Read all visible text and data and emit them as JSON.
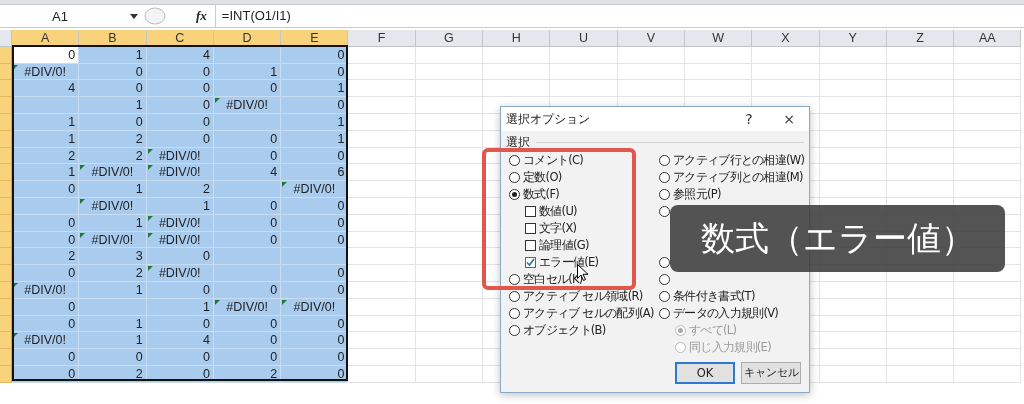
{
  "formula_bar": {
    "name_box": "A1",
    "fx": "fx",
    "formula": "=INT(O1/I1)"
  },
  "sheet": {
    "columns": [
      {
        "label": "A",
        "selected": true
      },
      {
        "label": "B",
        "selected": true
      },
      {
        "label": "C",
        "selected": true
      },
      {
        "label": "D",
        "selected": true
      },
      {
        "label": "E",
        "selected": true
      },
      {
        "label": "F",
        "selected": false
      },
      {
        "label": "G",
        "selected": false
      },
      {
        "label": "H",
        "selected": false
      },
      {
        "label": "U",
        "selected": false
      },
      {
        "label": "V",
        "selected": false
      },
      {
        "label": "W",
        "selected": false
      },
      {
        "label": "X",
        "selected": false
      },
      {
        "label": "Y",
        "selected": false
      },
      {
        "label": "Z",
        "selected": false
      },
      {
        "label": "AA",
        "selected": false
      }
    ],
    "rows": [
      [
        "0",
        "1",
        "4",
        null,
        "0"
      ],
      [
        {
          "text": "#DIV/0!",
          "kind": "error"
        },
        "0",
        "0",
        "1",
        "0"
      ],
      [
        "4",
        "0",
        "0",
        "0",
        "1"
      ],
      [
        null,
        "1",
        "0",
        {
          "text": "#DIV/0!",
          "kind": "error"
        },
        "0"
      ],
      [
        "1",
        "0",
        "0",
        null,
        "1"
      ],
      [
        "1",
        "2",
        "0",
        "0",
        "1"
      ],
      [
        "2",
        "2",
        {
          "text": "#DIV/0!",
          "kind": "error"
        },
        "0",
        "0"
      ],
      [
        "1",
        {
          "text": "#DIV/0!",
          "kind": "error"
        },
        {
          "text": "#DIV/0!",
          "kind": "error"
        },
        "4",
        "6"
      ],
      [
        "0",
        "1",
        "2",
        null,
        {
          "text": "#DIV/0!",
          "kind": "error"
        }
      ],
      [
        null,
        {
          "text": "#DIV/0!",
          "kind": "error"
        },
        "1",
        "0",
        "0"
      ],
      [
        "0",
        "1",
        {
          "text": "#DIV/0!",
          "kind": "error"
        },
        "0",
        "0"
      ],
      [
        "0",
        {
          "text": "#DIV/0!",
          "kind": "error"
        },
        {
          "text": "#DIV/0!",
          "kind": "error"
        },
        "0",
        "0"
      ],
      [
        "2",
        "3",
        "0",
        null,
        null
      ],
      [
        "0",
        "2",
        {
          "text": "#DIV/0!",
          "kind": "error"
        },
        null,
        "0"
      ],
      [
        {
          "text": "#DIV/0!",
          "kind": "error"
        },
        "1",
        "0",
        "0",
        "0"
      ],
      [
        "0",
        null,
        "1",
        {
          "text": "#DIV/0!",
          "kind": "error"
        },
        {
          "text": "#DIV/0!",
          "kind": "error"
        }
      ],
      [
        "0",
        "1",
        "0",
        "0",
        "0"
      ],
      [
        {
          "text": "#DIV/0!",
          "kind": "error"
        },
        "1",
        "4",
        "0",
        "0"
      ],
      [
        "0",
        "0",
        "0",
        "0",
        "0"
      ],
      [
        "0",
        "2",
        "0",
        "2",
        "0"
      ]
    ]
  },
  "dialog": {
    "title": "選択オプション",
    "help": "?",
    "close": "×",
    "group": "選択",
    "left": [
      {
        "kind": "radio",
        "label": "コメント(C)",
        "selected": false
      },
      {
        "kind": "radio",
        "label": "定数(O)",
        "selected": false
      },
      {
        "kind": "radio",
        "label": "数式(F)",
        "selected": true
      },
      {
        "kind": "check",
        "label": "数値(U)",
        "checked": false
      },
      {
        "kind": "check",
        "label": "文字(X)",
        "checked": false
      },
      {
        "kind": "check",
        "label": "論理値(G)",
        "checked": false
      },
      {
        "kind": "check",
        "label": "エラー値(E)",
        "checked": true
      },
      {
        "kind": "radio",
        "label": "空白セル(K)",
        "selected": false
      },
      {
        "kind": "radio",
        "label": "アクティブ セル領域(R)",
        "selected": false
      },
      {
        "kind": "radio",
        "label": "アクティブ セルの配列(A)",
        "selected": false
      },
      {
        "kind": "radio",
        "label": "オブジェクト(B)",
        "selected": false
      }
    ],
    "right_top": [
      {
        "kind": "radio",
        "label": "アクティブ行との相違(W)",
        "selected": false
      },
      {
        "kind": "radio",
        "label": "アクティブ列との相違(M)",
        "selected": false
      },
      {
        "kind": "radio",
        "label": "参照元(P)",
        "selected": false
      },
      {
        "kind": "radio",
        "selected": false
      }
    ],
    "right_bottom": [
      {
        "kind": "radio",
        "selected": false
      },
      {
        "kind": "radio",
        "selected": false
      },
      {
        "kind": "radio",
        "label": "条件付き書式(T)",
        "selected": false
      },
      {
        "kind": "radio",
        "label": "データの入力規則(V)",
        "selected": false
      },
      {
        "kind": "subradio",
        "label": "すべて(L)",
        "selected": true,
        "disabled": true
      },
      {
        "kind": "subradio",
        "label": "同じ入力規則(E)",
        "selected": false,
        "disabled": true
      }
    ],
    "ok": "OK",
    "cancel": "キャンセル"
  },
  "caption": "数式（エラー値）"
}
